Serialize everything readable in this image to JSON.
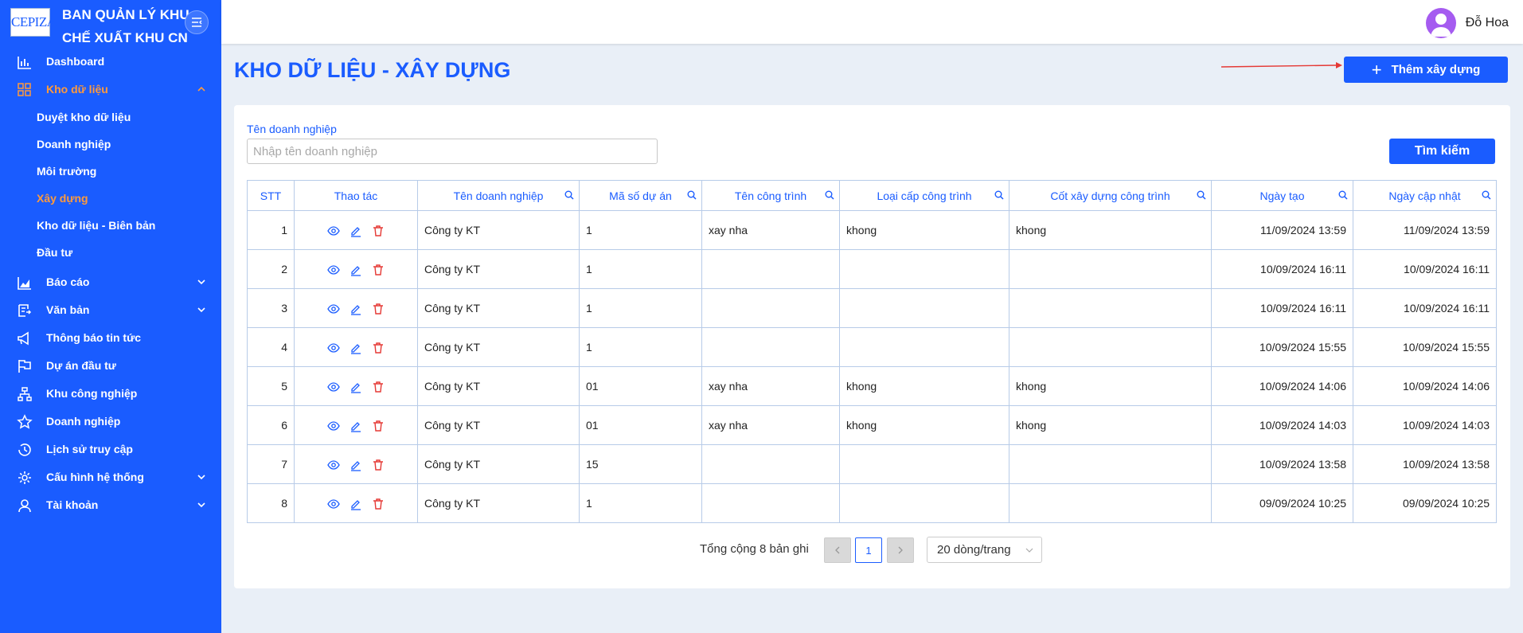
{
  "sidebar": {
    "logo_text": "CEPIZA",
    "brand": "BAN QUẢN LÝ KHU\nCHẾ XUẤT KHU CN",
    "nav": {
      "dashboard": "Dashboard",
      "kho_du_lieu": "Kho dữ liệu",
      "bao_cao": "Báo cáo",
      "van_ban": "Văn bản",
      "thong_bao": "Thông báo tin tức",
      "du_an": "Dự án đầu tư",
      "khu_cong_nghiep": "Khu công nghiệp",
      "doanh_nghiep": "Doanh nghiệp",
      "lich_su": "Lịch sử truy cập",
      "cau_hinh": "Cấu hình hệ thống",
      "tai_khoan": "Tài khoản"
    },
    "sub": {
      "duyet": "Duyệt kho dữ liệu",
      "doanh_nghiep": "Doanh nghiệp",
      "moi_truong": "Môi trường",
      "xay_dung": "Xây dựng",
      "bien_ban": "Kho dữ liệu - Biên bản",
      "dau_tu": "Đầu tư"
    }
  },
  "header": {
    "user_name": "Đỗ Hoa"
  },
  "page": {
    "title": "KHO DỮ LIỆU - XÂY DỰNG",
    "add_button": "Thêm xây dựng"
  },
  "filter": {
    "label": "Tên doanh nghiệp",
    "placeholder": "Nhập tên doanh nghiệp",
    "search_button": "Tìm kiếm"
  },
  "table": {
    "headers": {
      "stt": "STT",
      "thao_tac": "Thao tác",
      "ten_dn": "Tên doanh nghiệp",
      "ma_so": "Mã số dự án",
      "ten_ct": "Tên công trình",
      "loai_cap": "Loại cấp công trình",
      "cot_xd": "Cốt xây dựng công trình",
      "ngay_tao": "Ngày tạo",
      "ngay_cn": "Ngày cập nhật"
    },
    "rows": [
      [
        "1",
        "Công ty KT",
        "1",
        "xay nha",
        "khong",
        "khong",
        "11/09/2024 13:59",
        "11/09/2024 13:59"
      ],
      [
        "2",
        "Công ty KT",
        "1",
        "",
        "",
        "",
        "10/09/2024 16:11",
        "10/09/2024 16:11"
      ],
      [
        "3",
        "Công ty KT",
        "1",
        "",
        "",
        "",
        "10/09/2024 16:11",
        "10/09/2024 16:11"
      ],
      [
        "4",
        "Công ty KT",
        "1",
        "",
        "",
        "",
        "10/09/2024 15:55",
        "10/09/2024 15:55"
      ],
      [
        "5",
        "Công ty KT",
        "01",
        "xay nha",
        "khong",
        "khong",
        "10/09/2024 14:06",
        "10/09/2024 14:06"
      ],
      [
        "6",
        "Công ty KT",
        "01",
        "xay nha",
        "khong",
        "khong",
        "10/09/2024 14:03",
        "10/09/2024 14:03"
      ],
      [
        "7",
        "Công ty KT",
        "15",
        "",
        "",
        "",
        "10/09/2024 13:58",
        "10/09/2024 13:58"
      ],
      [
        "8",
        "Công ty KT",
        "1",
        "",
        "",
        "",
        "09/09/2024 10:25",
        "09/09/2024 10:25"
      ]
    ]
  },
  "pagination": {
    "total_text": "Tổng cộng 8 bản ghi",
    "current_page": "1",
    "page_size": "20 dòng/trang"
  }
}
